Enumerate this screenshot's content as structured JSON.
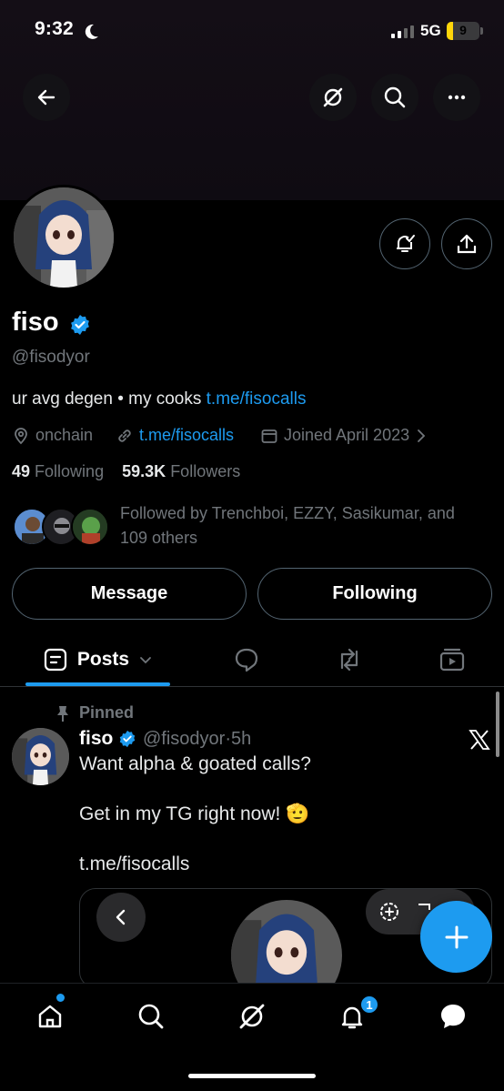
{
  "status_bar": {
    "time": "9:32",
    "network": "5G",
    "battery_level": "9",
    "battery_fraction": 0.2
  },
  "header": {
    "back_icon": "arrow-left-icon",
    "grok_icon": "grok-icon",
    "search_icon": "search-icon",
    "more_icon": "more-icon"
  },
  "profile": {
    "name": "fiso",
    "handle": "@fisodyor",
    "bio_text": "ur avg degen • my cooks ",
    "bio_link": "t.me/fisocalls",
    "location": "onchain",
    "website": "t.me/fisocalls",
    "joined": "Joined April 2023",
    "following_count": "49",
    "following_label": "Following",
    "followers_count": "59.3K",
    "followers_label": "Followers",
    "followed_by_text": "Followed by Trenchboi, EZZY, Sasikumar, and 109 others"
  },
  "actions": {
    "message_label": "Message",
    "following_label": "Following"
  },
  "tabs": {
    "posts_label": "Posts"
  },
  "post": {
    "pinned_label": "Pinned",
    "author_name": "fiso",
    "author_handle": "@fisodyor",
    "time_sep": "·",
    "time_ago": "5h",
    "line1": "Want alpha & goated calls?",
    "line2": "Get in my TG right now! 🫡",
    "link": "t.me/fisocalls"
  },
  "nav": {
    "notifications_badge": "1"
  },
  "colors": {
    "accent": "#1d9bf0",
    "background": "#000000",
    "muted": "#71767b",
    "border": "#2f3336"
  }
}
